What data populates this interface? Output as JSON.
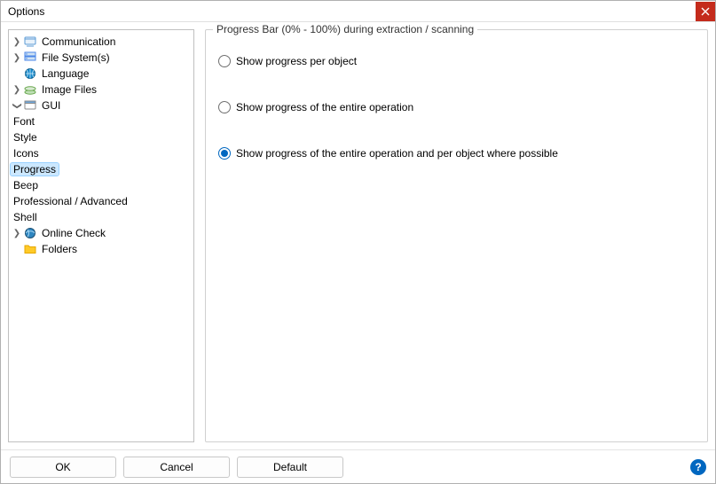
{
  "window": {
    "title": "Options"
  },
  "tree": {
    "communication": "Communication",
    "file_system": "File System(s)",
    "language": "Language",
    "image_files": "Image Files",
    "gui": "GUI",
    "gui_children": {
      "font": "Font",
      "style": "Style",
      "icons": "Icons",
      "progress": "Progress",
      "beep": "Beep",
      "professional": "Professional / Advanced",
      "shell": "Shell"
    },
    "online_check": "Online Check",
    "folders": "Folders"
  },
  "panel": {
    "legend": "Progress Bar (0% - 100%) during extraction / scanning",
    "opt1": "Show progress per object",
    "opt2": "Show progress of the entire operation",
    "opt3": "Show progress of the entire operation and per object where possible"
  },
  "buttons": {
    "ok": "OK",
    "cancel": "Cancel",
    "default": "Default"
  }
}
